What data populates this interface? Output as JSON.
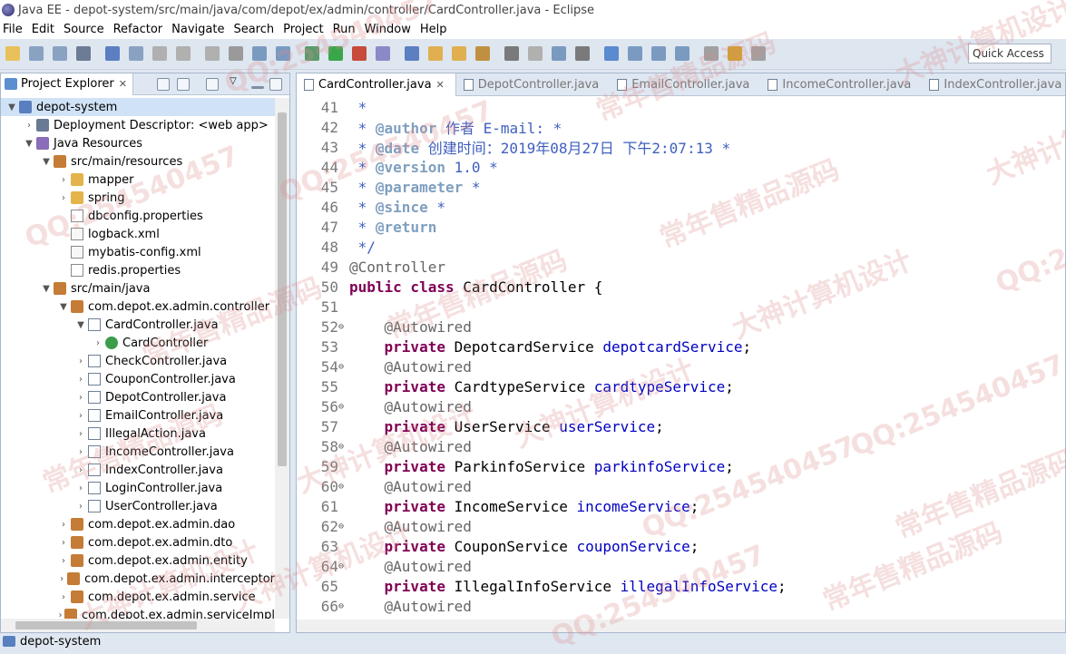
{
  "window": {
    "title": "Java EE - depot-system/src/main/java/com/depot/ex/admin/controller/CardController.java - Eclipse"
  },
  "menu": [
    "File",
    "Edit",
    "Source",
    "Refactor",
    "Navigate",
    "Search",
    "Project",
    "Run",
    "Window",
    "Help"
  ],
  "toolbar": {
    "quick_access_label": "Quick Access"
  },
  "project_explorer": {
    "tab_label": "Project Explorer",
    "tab_close": "✕",
    "tree": [
      {
        "label": "depot-system",
        "indent": 0,
        "arrow": "▼",
        "icon": "project",
        "selected": true
      },
      {
        "label": "Deployment Descriptor: <web app>",
        "indent": 1,
        "arrow": "›",
        "icon": "dd"
      },
      {
        "label": "Java Resources",
        "indent": 1,
        "arrow": "▼",
        "icon": "lib"
      },
      {
        "label": "src/main/resources",
        "indent": 2,
        "arrow": "▼",
        "icon": "package"
      },
      {
        "label": "mapper",
        "indent": 3,
        "arrow": "›",
        "icon": "folder"
      },
      {
        "label": "spring",
        "indent": 3,
        "arrow": "›",
        "icon": "folder"
      },
      {
        "label": "dbconfig.properties",
        "indent": 3,
        "arrow": "",
        "icon": "file"
      },
      {
        "label": "logback.xml",
        "indent": 3,
        "arrow": "",
        "icon": "xml"
      },
      {
        "label": "mybatis-config.xml",
        "indent": 3,
        "arrow": "",
        "icon": "xml"
      },
      {
        "label": "redis.properties",
        "indent": 3,
        "arrow": "",
        "icon": "file"
      },
      {
        "label": "src/main/java",
        "indent": 2,
        "arrow": "▼",
        "icon": "package"
      },
      {
        "label": "com.depot.ex.admin.controller",
        "indent": 3,
        "arrow": "▼",
        "icon": "package"
      },
      {
        "label": "CardController.java",
        "indent": 4,
        "arrow": "▼",
        "icon": "java"
      },
      {
        "label": "CardController",
        "indent": 5,
        "arrow": "›",
        "icon": "class"
      },
      {
        "label": "CheckController.java",
        "indent": 4,
        "arrow": "›",
        "icon": "java"
      },
      {
        "label": "CouponController.java",
        "indent": 4,
        "arrow": "›",
        "icon": "java"
      },
      {
        "label": "DepotController.java",
        "indent": 4,
        "arrow": "›",
        "icon": "java"
      },
      {
        "label": "EmailController.java",
        "indent": 4,
        "arrow": "›",
        "icon": "java"
      },
      {
        "label": "IllegalAction.java",
        "indent": 4,
        "arrow": "›",
        "icon": "java"
      },
      {
        "label": "IncomeController.java",
        "indent": 4,
        "arrow": "›",
        "icon": "java"
      },
      {
        "label": "IndexController.java",
        "indent": 4,
        "arrow": "›",
        "icon": "java"
      },
      {
        "label": "LoginController.java",
        "indent": 4,
        "arrow": "›",
        "icon": "java"
      },
      {
        "label": "UserController.java",
        "indent": 4,
        "arrow": "›",
        "icon": "java"
      },
      {
        "label": "com.depot.ex.admin.dao",
        "indent": 3,
        "arrow": "›",
        "icon": "package"
      },
      {
        "label": "com.depot.ex.admin.dto",
        "indent": 3,
        "arrow": "›",
        "icon": "package"
      },
      {
        "label": "com.depot.ex.admin.entity",
        "indent": 3,
        "arrow": "›",
        "icon": "package"
      },
      {
        "label": "com.depot.ex.admin.interceptor",
        "indent": 3,
        "arrow": "›",
        "icon": "package"
      },
      {
        "label": "com.depot.ex.admin.service",
        "indent": 3,
        "arrow": "›",
        "icon": "package"
      },
      {
        "label": "com.depot.ex.admin.serviceImpl",
        "indent": 3,
        "arrow": "›",
        "icon": "package"
      }
    ]
  },
  "editor": {
    "tabs": [
      {
        "label": "CardController.java",
        "active": true,
        "close": "✕"
      },
      {
        "label": "DepotController.java",
        "active": false
      },
      {
        "label": "EmailController.java",
        "active": false
      },
      {
        "label": "IncomeController.java",
        "active": false
      },
      {
        "label": "IndexController.java",
        "active": false
      }
    ],
    "lines": [
      {
        "num": "41",
        "fold": "",
        "segs": [
          {
            "t": " *",
            "c": "cmt"
          }
        ]
      },
      {
        "num": "42",
        "fold": "",
        "segs": [
          {
            "t": " * ",
            "c": "cmt"
          },
          {
            "t": "@author",
            "c": "tag"
          },
          {
            "t": " 作者 E-mail: *",
            "c": "cmt"
          }
        ]
      },
      {
        "num": "43",
        "fold": "",
        "segs": [
          {
            "t": " * ",
            "c": "cmt"
          },
          {
            "t": "@date",
            "c": "tag"
          },
          {
            "t": " 创建时间：2019年08月27日 下午2:07:13 *",
            "c": "cmt"
          }
        ]
      },
      {
        "num": "44",
        "fold": "",
        "segs": [
          {
            "t": " * ",
            "c": "cmt"
          },
          {
            "t": "@version",
            "c": "tag"
          },
          {
            "t": " 1.0 *",
            "c": "cmt"
          }
        ]
      },
      {
        "num": "45",
        "fold": "",
        "segs": [
          {
            "t": " * ",
            "c": "cmt"
          },
          {
            "t": "@parameter",
            "c": "tag"
          },
          {
            "t": " *",
            "c": "cmt"
          }
        ]
      },
      {
        "num": "46",
        "fold": "",
        "segs": [
          {
            "t": " * ",
            "c": "cmt"
          },
          {
            "t": "@since",
            "c": "tag"
          },
          {
            "t": " *",
            "c": "cmt"
          }
        ]
      },
      {
        "num": "47",
        "fold": "",
        "segs": [
          {
            "t": " * ",
            "c": "cmt"
          },
          {
            "t": "@return",
            "c": "tag"
          }
        ]
      },
      {
        "num": "48",
        "fold": "",
        "segs": [
          {
            "t": " */",
            "c": "cmt"
          }
        ]
      },
      {
        "num": "49",
        "fold": "",
        "segs": [
          {
            "t": "@Controller",
            "c": "ann"
          }
        ]
      },
      {
        "num": "50",
        "fold": "",
        "segs": [
          {
            "t": "public class",
            "c": "kw"
          },
          {
            "t": " CardController {",
            "c": "ct"
          }
        ]
      },
      {
        "num": "51",
        "fold": "",
        "segs": []
      },
      {
        "num": "52",
        "fold": "⊖",
        "segs": [
          {
            "t": "    @Autowired",
            "c": "ann"
          }
        ]
      },
      {
        "num": "53",
        "fold": "",
        "segs": [
          {
            "t": "    ",
            "c": "ct"
          },
          {
            "t": "private",
            "c": "kw"
          },
          {
            "t": " DepotcardService ",
            "c": "ct"
          },
          {
            "t": "depotcardService",
            "c": "fld"
          },
          {
            "t": ";",
            "c": "ct"
          }
        ]
      },
      {
        "num": "54",
        "fold": "⊖",
        "segs": [
          {
            "t": "    @Autowired",
            "c": "ann"
          }
        ]
      },
      {
        "num": "55",
        "fold": "",
        "segs": [
          {
            "t": "    ",
            "c": "ct"
          },
          {
            "t": "private",
            "c": "kw"
          },
          {
            "t": " CardtypeService ",
            "c": "ct"
          },
          {
            "t": "cardtypeService",
            "c": "fld"
          },
          {
            "t": ";",
            "c": "ct"
          }
        ]
      },
      {
        "num": "56",
        "fold": "⊖",
        "segs": [
          {
            "t": "    @Autowired",
            "c": "ann"
          }
        ]
      },
      {
        "num": "57",
        "fold": "",
        "segs": [
          {
            "t": "    ",
            "c": "ct"
          },
          {
            "t": "private",
            "c": "kw"
          },
          {
            "t": " UserService ",
            "c": "ct"
          },
          {
            "t": "userService",
            "c": "fld"
          },
          {
            "t": ";",
            "c": "ct"
          }
        ]
      },
      {
        "num": "58",
        "fold": "⊖",
        "segs": [
          {
            "t": "    @Autowired",
            "c": "ann"
          }
        ]
      },
      {
        "num": "59",
        "fold": "",
        "segs": [
          {
            "t": "    ",
            "c": "ct"
          },
          {
            "t": "private",
            "c": "kw"
          },
          {
            "t": " ParkinfoService ",
            "c": "ct"
          },
          {
            "t": "parkinfoService",
            "c": "fld"
          },
          {
            "t": ";",
            "c": "ct"
          }
        ]
      },
      {
        "num": "60",
        "fold": "⊖",
        "segs": [
          {
            "t": "    @Autowired",
            "c": "ann"
          }
        ]
      },
      {
        "num": "61",
        "fold": "",
        "segs": [
          {
            "t": "    ",
            "c": "ct"
          },
          {
            "t": "private",
            "c": "kw"
          },
          {
            "t": " IncomeService ",
            "c": "ct"
          },
          {
            "t": "incomeService",
            "c": "fld"
          },
          {
            "t": ";",
            "c": "ct"
          }
        ]
      },
      {
        "num": "62",
        "fold": "⊖",
        "segs": [
          {
            "t": "    @Autowired",
            "c": "ann"
          }
        ]
      },
      {
        "num": "63",
        "fold": "",
        "segs": [
          {
            "t": "    ",
            "c": "ct"
          },
          {
            "t": "private",
            "c": "kw"
          },
          {
            "t": " CouponService ",
            "c": "ct"
          },
          {
            "t": "couponService",
            "c": "fld"
          },
          {
            "t": ";",
            "c": "ct"
          }
        ]
      },
      {
        "num": "64",
        "fold": "⊖",
        "segs": [
          {
            "t": "    @Autowired",
            "c": "ann"
          }
        ]
      },
      {
        "num": "65",
        "fold": "",
        "segs": [
          {
            "t": "    ",
            "c": "ct"
          },
          {
            "t": "private",
            "c": "kw"
          },
          {
            "t": " IllegalInfoService ",
            "c": "ct"
          },
          {
            "t": "illegalInfoService",
            "c": "fld"
          },
          {
            "t": ";",
            "c": "ct"
          }
        ]
      },
      {
        "num": "66",
        "fold": "⊖",
        "segs": [
          {
            "t": "    @Autowired",
            "c": "ann"
          }
        ]
      }
    ]
  },
  "status": {
    "text": "depot-system"
  },
  "watermarks": [
    "QQ:254540457",
    "常年售精品源码",
    "大神计算机设计"
  ]
}
